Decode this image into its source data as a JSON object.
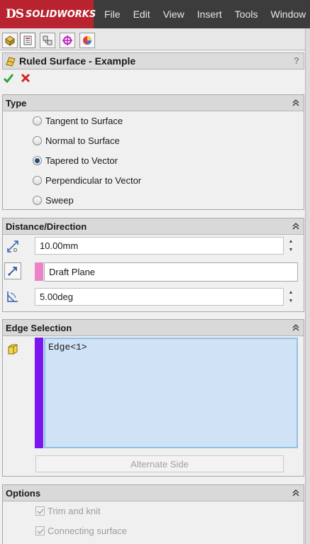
{
  "app": {
    "brand_ds": "DS",
    "brand_name": "SOLIDWORKS"
  },
  "menu": [
    "File",
    "Edit",
    "View",
    "Insert",
    "Tools",
    "Window"
  ],
  "tabs": [
    {
      "icon": "feature-manager-icon"
    },
    {
      "icon": "property-manager-icon"
    },
    {
      "icon": "configuration-manager-icon"
    },
    {
      "icon": "dimxpert-manager-icon"
    },
    {
      "icon": "display-manager-icon"
    }
  ],
  "pm": {
    "title": "Ruled Surface - Example",
    "help": "?"
  },
  "type_group": {
    "title": "Type",
    "options": [
      {
        "label": "Tangent to Surface",
        "selected": false
      },
      {
        "label": "Normal to Surface",
        "selected": false
      },
      {
        "label": "Tapered to Vector",
        "selected": true
      },
      {
        "label": "Perpendicular to Vector",
        "selected": false
      },
      {
        "label": "Sweep",
        "selected": false
      }
    ]
  },
  "distance_group": {
    "title": "Distance/Direction",
    "distance": "10.00mm",
    "reference": "Draft Plane",
    "angle": "5.00deg"
  },
  "edge_group": {
    "title": "Edge Selection",
    "selection": "Edge<1>",
    "alternate_side": "Alternate Side"
  },
  "options_group": {
    "title": "Options",
    "trim_and_knit": "Trim and knit",
    "connecting_surface": "Connecting surface"
  },
  "colors": {
    "brand_red": "#b8232f",
    "reference_swatch": "#ee82c8",
    "selection_swatch": "#7a16f0",
    "selection_box": "#cfe2f6"
  }
}
